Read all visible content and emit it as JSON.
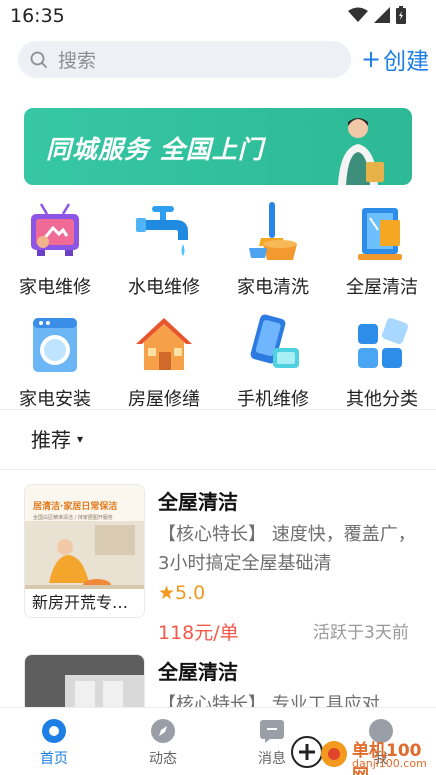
{
  "status_bar": {
    "time": "16:35"
  },
  "search": {
    "placeholder": "搜索"
  },
  "header": {
    "create_label": "创建",
    "create_plus": "+"
  },
  "banner": {
    "text": "同城服务 全国上门"
  },
  "categories": [
    {
      "label": "家电维修",
      "icon": "tv-repair-icon"
    },
    {
      "label": "水电维修",
      "icon": "faucet-icon"
    },
    {
      "label": "家电清洗",
      "icon": "mop-bucket-icon"
    },
    {
      "label": "全屋清洁",
      "icon": "window-cleaning-icon"
    },
    {
      "label": "家电安装",
      "icon": "washing-machine-icon"
    },
    {
      "label": "房屋修缮",
      "icon": "house-icon"
    },
    {
      "label": "手机维修",
      "icon": "phone-repair-icon"
    },
    {
      "label": "其他分类",
      "icon": "grid-icon"
    }
  ],
  "recommend": {
    "label": "推荐",
    "caret": "▾"
  },
  "services": [
    {
      "title": "全屋清洁",
      "description": "【核心特长】 速度快，覆盖广，3小时搞定全屋基础清",
      "rating": "★5.0",
      "price": "118元/单",
      "active": "活跃于3天前",
      "thumb_caption": "新房开荒专…",
      "thumb_headline": "居清洁·家居日常保洁",
      "thumb_subline": "全国白区精准清洁 / 持家居图开服务"
    },
    {
      "title": "全屋清洁",
      "description": "【核心特长】 专业工具应对"
    }
  ],
  "bottom_nav": [
    {
      "label": "首页",
      "icon": "home-icon",
      "active": true
    },
    {
      "label": "动态",
      "icon": "compass-icon",
      "active": false
    },
    {
      "label": "消息",
      "icon": "message-icon",
      "active": false
    },
    {
      "label": "我",
      "icon": "profile-icon",
      "active": false
    }
  ],
  "watermark": {
    "text": "单机100网",
    "sub": "danji100.com"
  },
  "colors": {
    "accent": "#1d7ee6",
    "banner": "#36c7a4",
    "price": "#f3584b",
    "rating": "#f39a1e"
  }
}
